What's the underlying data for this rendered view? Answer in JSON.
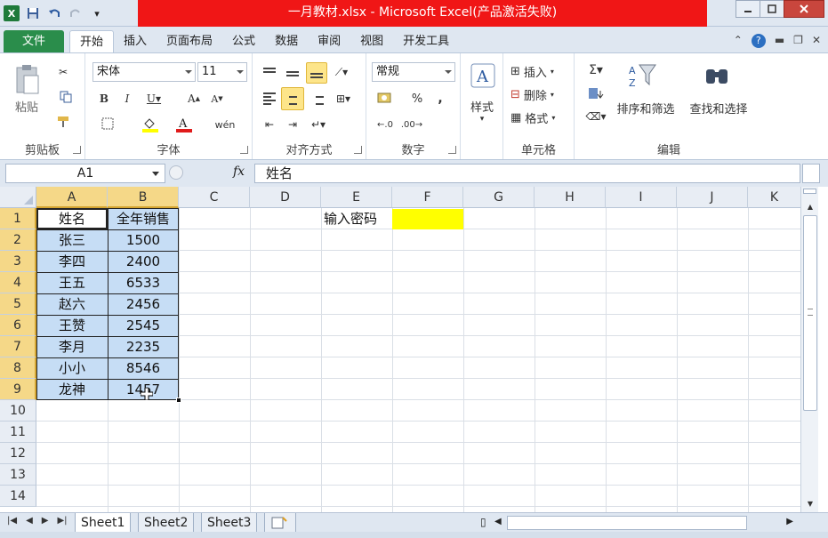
{
  "window": {
    "title": "一月教材.xlsx - Microsoft Excel(产品激活失败)"
  },
  "ribbon_tabs": [
    "文件",
    "开始",
    "插入",
    "页面布局",
    "公式",
    "数据",
    "审阅",
    "视图",
    "开发工具"
  ],
  "ribbon": {
    "clipboard": {
      "label": "剪贴板",
      "paste": "粘贴"
    },
    "font": {
      "label": "字体",
      "font_name": "宋体",
      "font_size": "11"
    },
    "alignment": {
      "label": "对齐方式"
    },
    "number": {
      "label": "数字",
      "format": "常规"
    },
    "styles": {
      "label": "样式"
    },
    "cells": {
      "label": "单元格",
      "insert": "插入",
      "delete": "删除",
      "format": "格式"
    },
    "editing": {
      "label": "编辑",
      "sort_filter": "排序和筛选",
      "find_select": "查找和选择"
    }
  },
  "formula_bar": {
    "name_box": "A1",
    "fx": "fx",
    "content": "姓名"
  },
  "columns": [
    "A",
    "B",
    "C",
    "D",
    "E",
    "F",
    "G",
    "H",
    "I",
    "J",
    "K"
  ],
  "rows": [
    "1",
    "2",
    "3",
    "4",
    "5",
    "6",
    "7",
    "8",
    "9",
    "10",
    "11",
    "12",
    "13",
    "14"
  ],
  "table": {
    "headers": [
      "姓名",
      "全年销售"
    ],
    "rows": [
      [
        "张三",
        "1500"
      ],
      [
        "李四",
        "2400"
      ],
      [
        "王五",
        "6533"
      ],
      [
        "赵六",
        "2456"
      ],
      [
        "王赞",
        "2545"
      ],
      [
        "李月",
        "2235"
      ],
      [
        "小小",
        "8546"
      ],
      [
        "龙神",
        "1457"
      ]
    ]
  },
  "password_label": "输入密码",
  "colors": {
    "title_band": "#f01616",
    "file_tab": "#2a8d4b",
    "selection": "#c6ddf5",
    "highlight_cell": "#ffff00"
  },
  "sheets": [
    "Sheet1",
    "Sheet2",
    "Sheet3"
  ]
}
